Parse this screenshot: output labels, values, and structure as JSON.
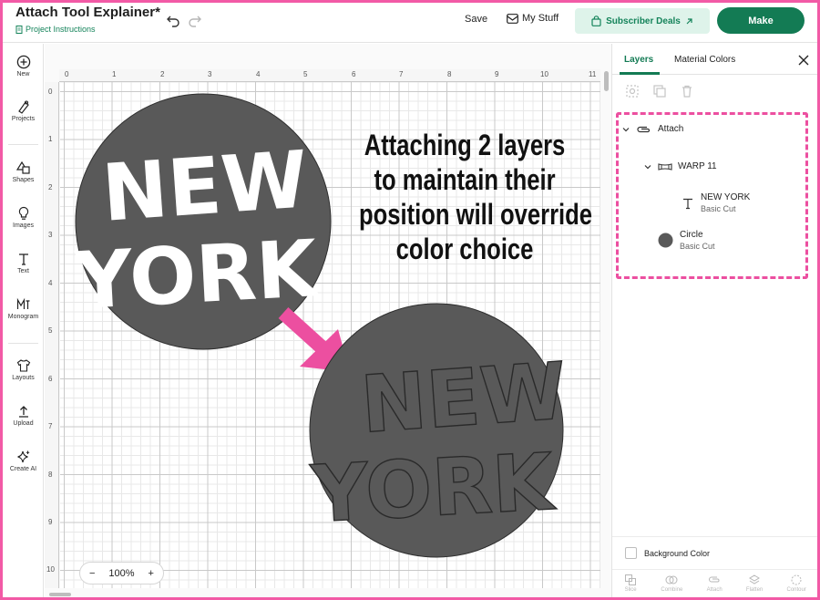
{
  "header": {
    "title": "Attach Tool Explainer*",
    "subtitle": "Project Instructions",
    "save_label": "Save",
    "mystuff_label": "My Stuff",
    "deals_label": "Subscriber Deals",
    "make_label": "Make",
    "accent": "#137b54"
  },
  "leftbar": {
    "items": [
      {
        "label": "New",
        "icon": "plus-circle-icon"
      },
      {
        "label": "Projects",
        "icon": "projects-icon"
      },
      {
        "label": "Shapes",
        "icon": "shapes-icon"
      },
      {
        "label": "Images",
        "icon": "lightbulb-icon"
      },
      {
        "label": "Text",
        "icon": "text-icon"
      },
      {
        "label": "Monogram",
        "icon": "monogram-icon"
      },
      {
        "label": "Layouts",
        "icon": "shirt-icon"
      },
      {
        "label": "Upload",
        "icon": "upload-icon"
      },
      {
        "label": "Create AI",
        "icon": "sparkle-icon"
      }
    ]
  },
  "canvas": {
    "ruler_top": [
      "0",
      "1",
      "2",
      "3",
      "4",
      "5",
      "6",
      "7",
      "8",
      "9",
      "10",
      "11"
    ],
    "ruler_left": [
      "0",
      "1",
      "2",
      "3",
      "4",
      "5",
      "6",
      "7",
      "8",
      "9",
      "10"
    ],
    "design_text_line1": "NEW",
    "design_text_line2": "YORK",
    "caption_lines": [
      "Attaching 2 layers",
      "to maintain their",
      "position will override",
      "color choice"
    ],
    "circle_color": "#595959",
    "arrow_color": "#ec4fa0",
    "zoom": {
      "minus": "−",
      "value": "100%",
      "plus": "+"
    }
  },
  "panel": {
    "tab_layers": "Layers",
    "tab_colors": "Material Colors",
    "layers": {
      "group": "Attach",
      "subgroup": "WARP 11",
      "text_layer": {
        "name": "NEW YORK",
        "sub": "Basic Cut"
      },
      "shape_layer": {
        "name": "Circle",
        "sub": "Basic Cut"
      }
    },
    "background_label": "Background Color",
    "bottom_actions": [
      "Slice",
      "Combine",
      "Attach",
      "Flatten",
      "Contour"
    ],
    "highlight_color": "#ec4fa0"
  }
}
